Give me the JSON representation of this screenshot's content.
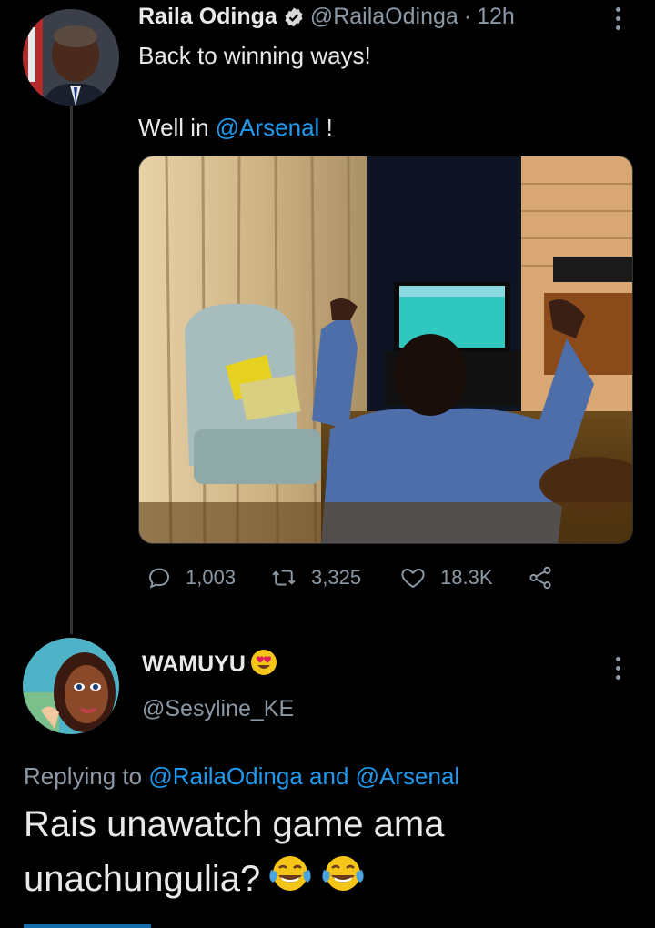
{
  "tweet": {
    "author_name": "Raila Odinga",
    "handle": "@RailaOdinga",
    "separator": "·",
    "time": "12h",
    "text_line1": "Back to winning ways!",
    "text_line2_prefix": "Well in ",
    "text_line2_mention": "@Arsenal",
    "text_line2_suffix": " !",
    "replies": "1,003",
    "retweets": "3,325",
    "likes": "18.3K",
    "verified_icon": "verified-badge-icon",
    "photo_description_icon": "tweet-photo"
  },
  "reply": {
    "author_name": "WAMUYU",
    "name_emoji": "heart-eyes-emoji",
    "handle": "@Sesyline_KE",
    "replying_prefix": "Replying to ",
    "replying_mention1": "@RailaOdinga",
    "replying_and": " and ",
    "replying_mention2": "@Arsenal",
    "text_line1": "Rais unawatch game ama",
    "text_line2": "unachungulia?",
    "text_emoji": "joy-emoji"
  },
  "colors": {
    "background": "#000000",
    "text": "#e7e9ea",
    "muted": "#8b98a5",
    "link": "#1d9bf0",
    "thread_line": "#333639"
  }
}
